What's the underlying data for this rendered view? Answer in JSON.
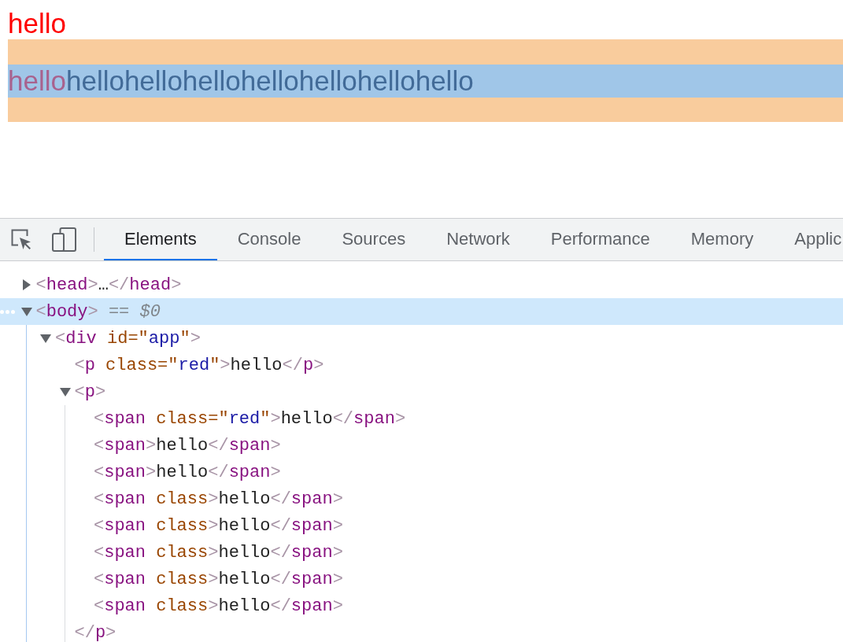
{
  "page": {
    "paragraph": "hello",
    "highlighted_paragraph": [
      {
        "text": "hello",
        "kind": "red"
      },
      {
        "text": "hello",
        "kind": "plain"
      },
      {
        "text": "hello",
        "kind": "plain"
      },
      {
        "text": "hello",
        "kind": "plain"
      },
      {
        "text": "hello",
        "kind": "plain"
      },
      {
        "text": "hello",
        "kind": "plain"
      },
      {
        "text": "hello",
        "kind": "plain"
      },
      {
        "text": "hello",
        "kind": "plain"
      }
    ]
  },
  "devtools": {
    "tabs": [
      {
        "label": "Elements",
        "selected": true
      },
      {
        "label": "Console",
        "selected": false
      },
      {
        "label": "Sources",
        "selected": false
      },
      {
        "label": "Network",
        "selected": false
      },
      {
        "label": "Performance",
        "selected": false
      },
      {
        "label": "Memory",
        "selected": false
      },
      {
        "label": "Applic",
        "selected": false
      }
    ],
    "dom_tree": [
      {
        "tokens": [
          {
            "kind": "punct",
            "text": "<"
          },
          {
            "kind": "tag",
            "text": "head"
          },
          {
            "kind": "punct",
            "text": ">"
          },
          {
            "kind": "text",
            "text": "…"
          },
          {
            "kind": "punct",
            "text": "</"
          },
          {
            "kind": "tag",
            "text": "head"
          },
          {
            "kind": "punct",
            "text": ">"
          }
        ],
        "expanded": false,
        "selected": false
      },
      {
        "tokens": [
          {
            "kind": "punct",
            "text": "<"
          },
          {
            "kind": "tag",
            "text": "body"
          },
          {
            "kind": "punct",
            "text": ">"
          },
          {
            "kind": "hint",
            "text": " == $0"
          }
        ],
        "expanded": true,
        "selected": true,
        "children": [
          {
            "tokens": [
              {
                "kind": "punct",
                "text": "<"
              },
              {
                "kind": "tag",
                "text": "div"
              },
              {
                "kind": "attr",
                "text": " id=\""
              },
              {
                "kind": "value",
                "text": "app"
              },
              {
                "kind": "attr",
                "text": "\""
              },
              {
                "kind": "punct",
                "text": ">"
              }
            ],
            "expanded": true,
            "selected": false,
            "children": [
              {
                "tokens": [
                  {
                    "kind": "punct",
                    "text": "<"
                  },
                  {
                    "kind": "tag",
                    "text": "p"
                  },
                  {
                    "kind": "attr",
                    "text": " class=\""
                  },
                  {
                    "kind": "value",
                    "text": "red"
                  },
                  {
                    "kind": "attr",
                    "text": "\""
                  },
                  {
                    "kind": "punct",
                    "text": ">"
                  },
                  {
                    "kind": "text",
                    "text": "hello"
                  },
                  {
                    "kind": "punct",
                    "text": "</"
                  },
                  {
                    "kind": "tag",
                    "text": "p"
                  },
                  {
                    "kind": "punct",
                    "text": ">"
                  }
                ],
                "selected": false
              },
              {
                "tokens": [
                  {
                    "kind": "punct",
                    "text": "<"
                  },
                  {
                    "kind": "tag",
                    "text": "p"
                  },
                  {
                    "kind": "punct",
                    "text": ">"
                  }
                ],
                "expanded": true,
                "selected": false,
                "hovered": true,
                "children": [
                  {
                    "tokens": [
                      {
                        "kind": "punct",
                        "text": "<"
                      },
                      {
                        "kind": "tag",
                        "text": "span"
                      },
                      {
                        "kind": "attr",
                        "text": " class=\""
                      },
                      {
                        "kind": "value",
                        "text": "red"
                      },
                      {
                        "kind": "attr",
                        "text": "\""
                      },
                      {
                        "kind": "punct",
                        "text": ">"
                      },
                      {
                        "kind": "text",
                        "text": "hello"
                      },
                      {
                        "kind": "punct",
                        "text": "</"
                      },
                      {
                        "kind": "tag",
                        "text": "span"
                      },
                      {
                        "kind": "punct",
                        "text": ">"
                      }
                    ],
                    "selected": false
                  },
                  {
                    "tokens": [
                      {
                        "kind": "punct",
                        "text": "<"
                      },
                      {
                        "kind": "tag",
                        "text": "span"
                      },
                      {
                        "kind": "punct",
                        "text": ">"
                      },
                      {
                        "kind": "text",
                        "text": "hello"
                      },
                      {
                        "kind": "punct",
                        "text": "</"
                      },
                      {
                        "kind": "tag",
                        "text": "span"
                      },
                      {
                        "kind": "punct",
                        "text": ">"
                      }
                    ],
                    "selected": false
                  },
                  {
                    "tokens": [
                      {
                        "kind": "punct",
                        "text": "<"
                      },
                      {
                        "kind": "tag",
                        "text": "span"
                      },
                      {
                        "kind": "punct",
                        "text": ">"
                      },
                      {
                        "kind": "text",
                        "text": "hello"
                      },
                      {
                        "kind": "punct",
                        "text": "</"
                      },
                      {
                        "kind": "tag",
                        "text": "span"
                      },
                      {
                        "kind": "punct",
                        "text": ">"
                      }
                    ],
                    "selected": false
                  },
                  {
                    "tokens": [
                      {
                        "kind": "punct",
                        "text": "<"
                      },
                      {
                        "kind": "tag",
                        "text": "span"
                      },
                      {
                        "kind": "attr",
                        "text": " class"
                      },
                      {
                        "kind": "punct",
                        "text": ">"
                      },
                      {
                        "kind": "text",
                        "text": "hello"
                      },
                      {
                        "kind": "punct",
                        "text": "</"
                      },
                      {
                        "kind": "tag",
                        "text": "span"
                      },
                      {
                        "kind": "punct",
                        "text": ">"
                      }
                    ],
                    "selected": false
                  },
                  {
                    "tokens": [
                      {
                        "kind": "punct",
                        "text": "<"
                      },
                      {
                        "kind": "tag",
                        "text": "span"
                      },
                      {
                        "kind": "attr",
                        "text": " class"
                      },
                      {
                        "kind": "punct",
                        "text": ">"
                      },
                      {
                        "kind": "text",
                        "text": "hello"
                      },
                      {
                        "kind": "punct",
                        "text": "</"
                      },
                      {
                        "kind": "tag",
                        "text": "span"
                      },
                      {
                        "kind": "punct",
                        "text": ">"
                      }
                    ],
                    "selected": false
                  },
                  {
                    "tokens": [
                      {
                        "kind": "punct",
                        "text": "<"
                      },
                      {
                        "kind": "tag",
                        "text": "span"
                      },
                      {
                        "kind": "attr",
                        "text": " class"
                      },
                      {
                        "kind": "punct",
                        "text": ">"
                      },
                      {
                        "kind": "text",
                        "text": "hello"
                      },
                      {
                        "kind": "punct",
                        "text": "</"
                      },
                      {
                        "kind": "tag",
                        "text": "span"
                      },
                      {
                        "kind": "punct",
                        "text": ">"
                      }
                    ],
                    "selected": false
                  },
                  {
                    "tokens": [
                      {
                        "kind": "punct",
                        "text": "<"
                      },
                      {
                        "kind": "tag",
                        "text": "span"
                      },
                      {
                        "kind": "attr",
                        "text": " class"
                      },
                      {
                        "kind": "punct",
                        "text": ">"
                      },
                      {
                        "kind": "text",
                        "text": "hello"
                      },
                      {
                        "kind": "punct",
                        "text": "</"
                      },
                      {
                        "kind": "tag",
                        "text": "span"
                      },
                      {
                        "kind": "punct",
                        "text": ">"
                      }
                    ],
                    "selected": false
                  },
                  {
                    "tokens": [
                      {
                        "kind": "punct",
                        "text": "<"
                      },
                      {
                        "kind": "tag",
                        "text": "span"
                      },
                      {
                        "kind": "attr",
                        "text": " class"
                      },
                      {
                        "kind": "punct",
                        "text": ">"
                      },
                      {
                        "kind": "text",
                        "text": "hello"
                      },
                      {
                        "kind": "punct",
                        "text": "</"
                      },
                      {
                        "kind": "tag",
                        "text": "span"
                      },
                      {
                        "kind": "punct",
                        "text": ">"
                      }
                    ],
                    "selected": false
                  }
                ],
                "closing_tokens": [
                  {
                    "kind": "punct",
                    "text": "</"
                  },
                  {
                    "kind": "tag",
                    "text": "p"
                  },
                  {
                    "kind": "punct",
                    "text": ">"
                  }
                ]
              }
            ]
          }
        ]
      }
    ]
  }
}
